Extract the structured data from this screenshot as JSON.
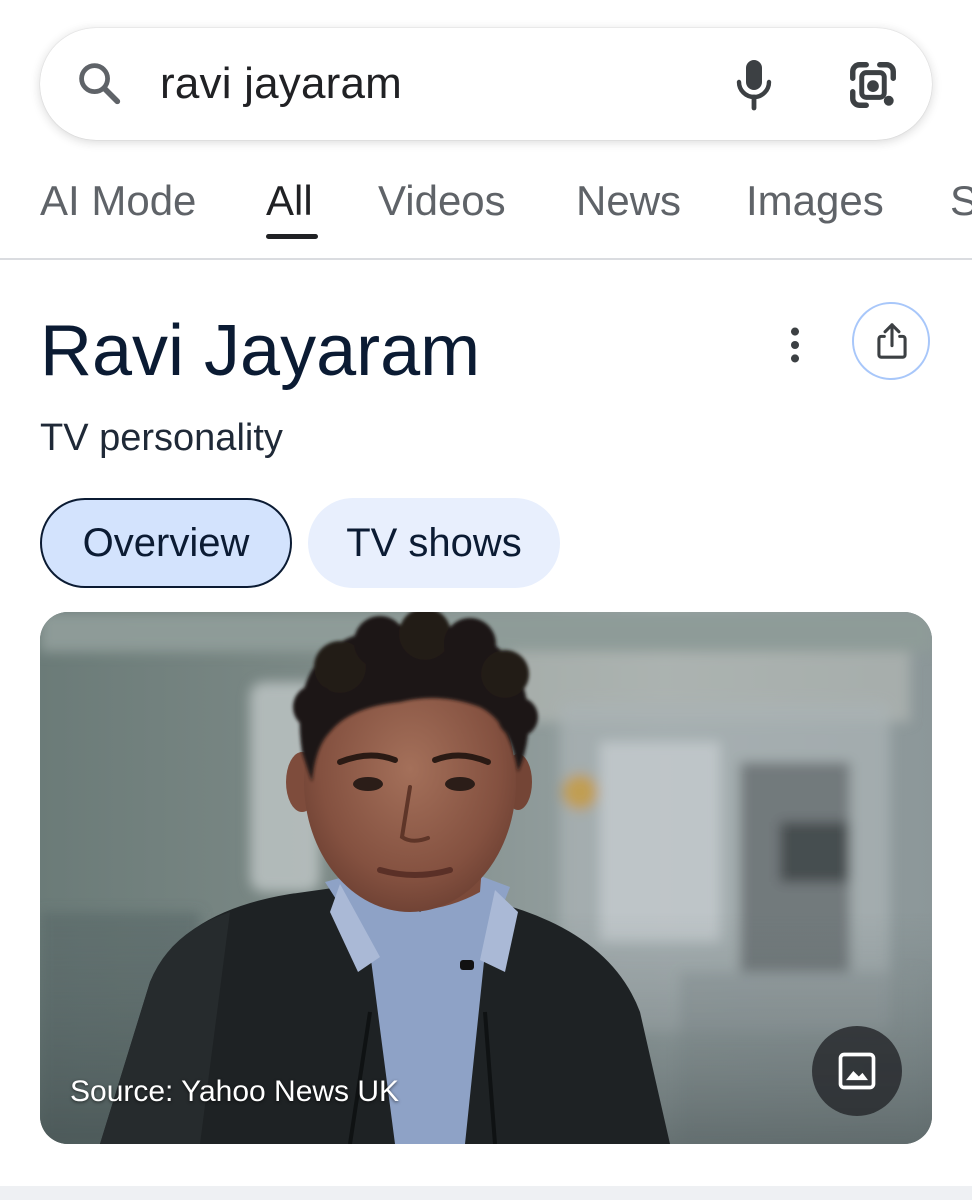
{
  "search": {
    "query": "ravi jayaram"
  },
  "icons": {
    "search": "search-icon",
    "mic": "mic-icon",
    "lens": "lens-icon",
    "more": "more-vert-icon",
    "share": "share-icon",
    "image": "image-icon"
  },
  "tabs": [
    {
      "label": "AI Mode",
      "active": false
    },
    {
      "label": "All",
      "active": true
    },
    {
      "label": "Videos",
      "active": false
    },
    {
      "label": "News",
      "active": false
    },
    {
      "label": "Images",
      "active": false
    },
    {
      "label": "S",
      "active": false
    }
  ],
  "knowledge_panel": {
    "title": "Ravi Jayaram",
    "subtitle": "TV personality",
    "chips": [
      {
        "label": "Overview",
        "selected": true
      },
      {
        "label": "TV shows",
        "selected": false
      }
    ],
    "image": {
      "source": "Source: Yahoo News UK"
    }
  },
  "colors": {
    "title": "#0b1b33",
    "chip_selected_bg": "#d3e3fd",
    "chip_bg": "#e8effd",
    "share_border": "#a8c7fa",
    "tab_inactive": "#5f6368",
    "tab_active": "#202124"
  }
}
